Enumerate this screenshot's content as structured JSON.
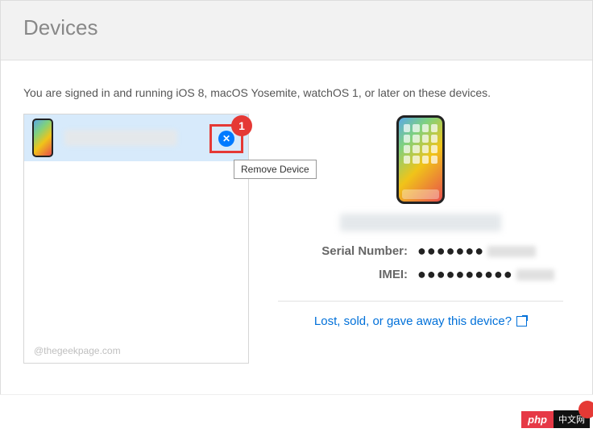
{
  "header": {
    "title": "Devices"
  },
  "intro": "You are signed in and running iOS 8, macOS Yosemite, watchOS 1, or later on these devices.",
  "deviceList": {
    "items": [
      {
        "name": "(device name redacted)"
      }
    ],
    "removeTooltip": "Remove Device",
    "watermark": "@thegeekpage.com"
  },
  "annotation": {
    "badge1": "1"
  },
  "details": {
    "deviceTitle": "(device title redacted)",
    "serialLabel": "Serial Number:",
    "serialValue": "●●●●●●●",
    "imeiLabel": "IMEI:",
    "imeiValue": "●●●●●●●●●●",
    "lostLink": "Lost, sold, or gave away this device?"
  },
  "footer": {
    "brand1": "php",
    "brand2": "中文网"
  }
}
